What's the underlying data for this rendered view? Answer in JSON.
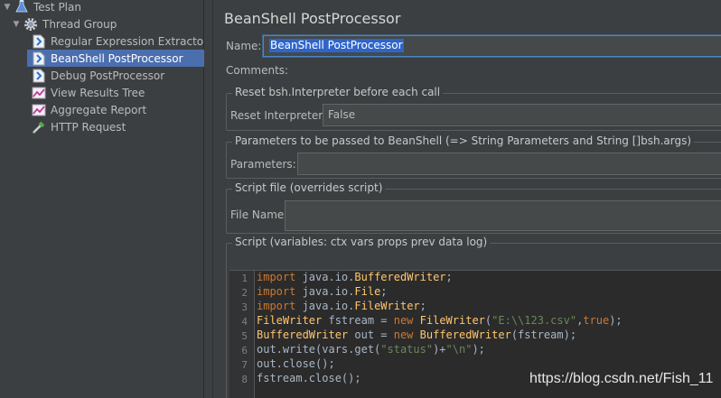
{
  "tree": {
    "items": [
      {
        "label": "Test Plan",
        "icon": "flask-icon"
      },
      {
        "label": "Thread Group",
        "icon": "gear-icon"
      },
      {
        "label": "Regular Expression Extractor",
        "icon": "document-icon"
      },
      {
        "label": "BeanShell PostProcessor",
        "icon": "document-icon"
      },
      {
        "label": "Debug PostProcessor",
        "icon": "document-icon"
      },
      {
        "label": "View Results Tree",
        "icon": "chart-icon"
      },
      {
        "label": "Aggregate Report",
        "icon": "chart-icon"
      },
      {
        "label": "HTTP Request",
        "icon": "pipette-icon"
      }
    ],
    "selected_index": 3
  },
  "panel": {
    "title": "BeanShell PostProcessor",
    "name_label": "Name:",
    "name_value": "BeanShell PostProcessor",
    "comments_label": "Comments:"
  },
  "reset_group": {
    "title": "Reset bsh.Interpreter before each call",
    "label": "Reset Interpreter:",
    "value": "False"
  },
  "params_group": {
    "title": "Parameters to be passed to BeanShell (=> String Parameters and String []bsh.args)",
    "label": "Parameters:",
    "value": ""
  },
  "file_group": {
    "title": "Script file (overrides script)",
    "label": "File Name:",
    "value": ""
  },
  "script_group": {
    "title": "Script (variables: ctx vars props prev data log)",
    "line_numbers": [
      "1",
      "2",
      "3",
      "4",
      "5",
      "6",
      "7",
      "8"
    ],
    "lines": [
      "import java.io.BufferedWriter;",
      "import java.io.File;",
      "import java.io.FileWriter;",
      "FileWriter fstream = new FileWriter(\"E:\\\\123.csv\",true);",
      "BufferedWriter out = new BufferedWriter(fstream);",
      "out.write(vars.get(\"status\")+\"\\n\");",
      "out.close();",
      "fstream.close();"
    ]
  },
  "watermark": "https://blog.csdn.net/Fish_11",
  "colors": {
    "background": "#3c3f41",
    "selection": "#4b6eaf",
    "keyword": "#cc7832",
    "string": "#6a8759",
    "class": "#ffc66d"
  }
}
